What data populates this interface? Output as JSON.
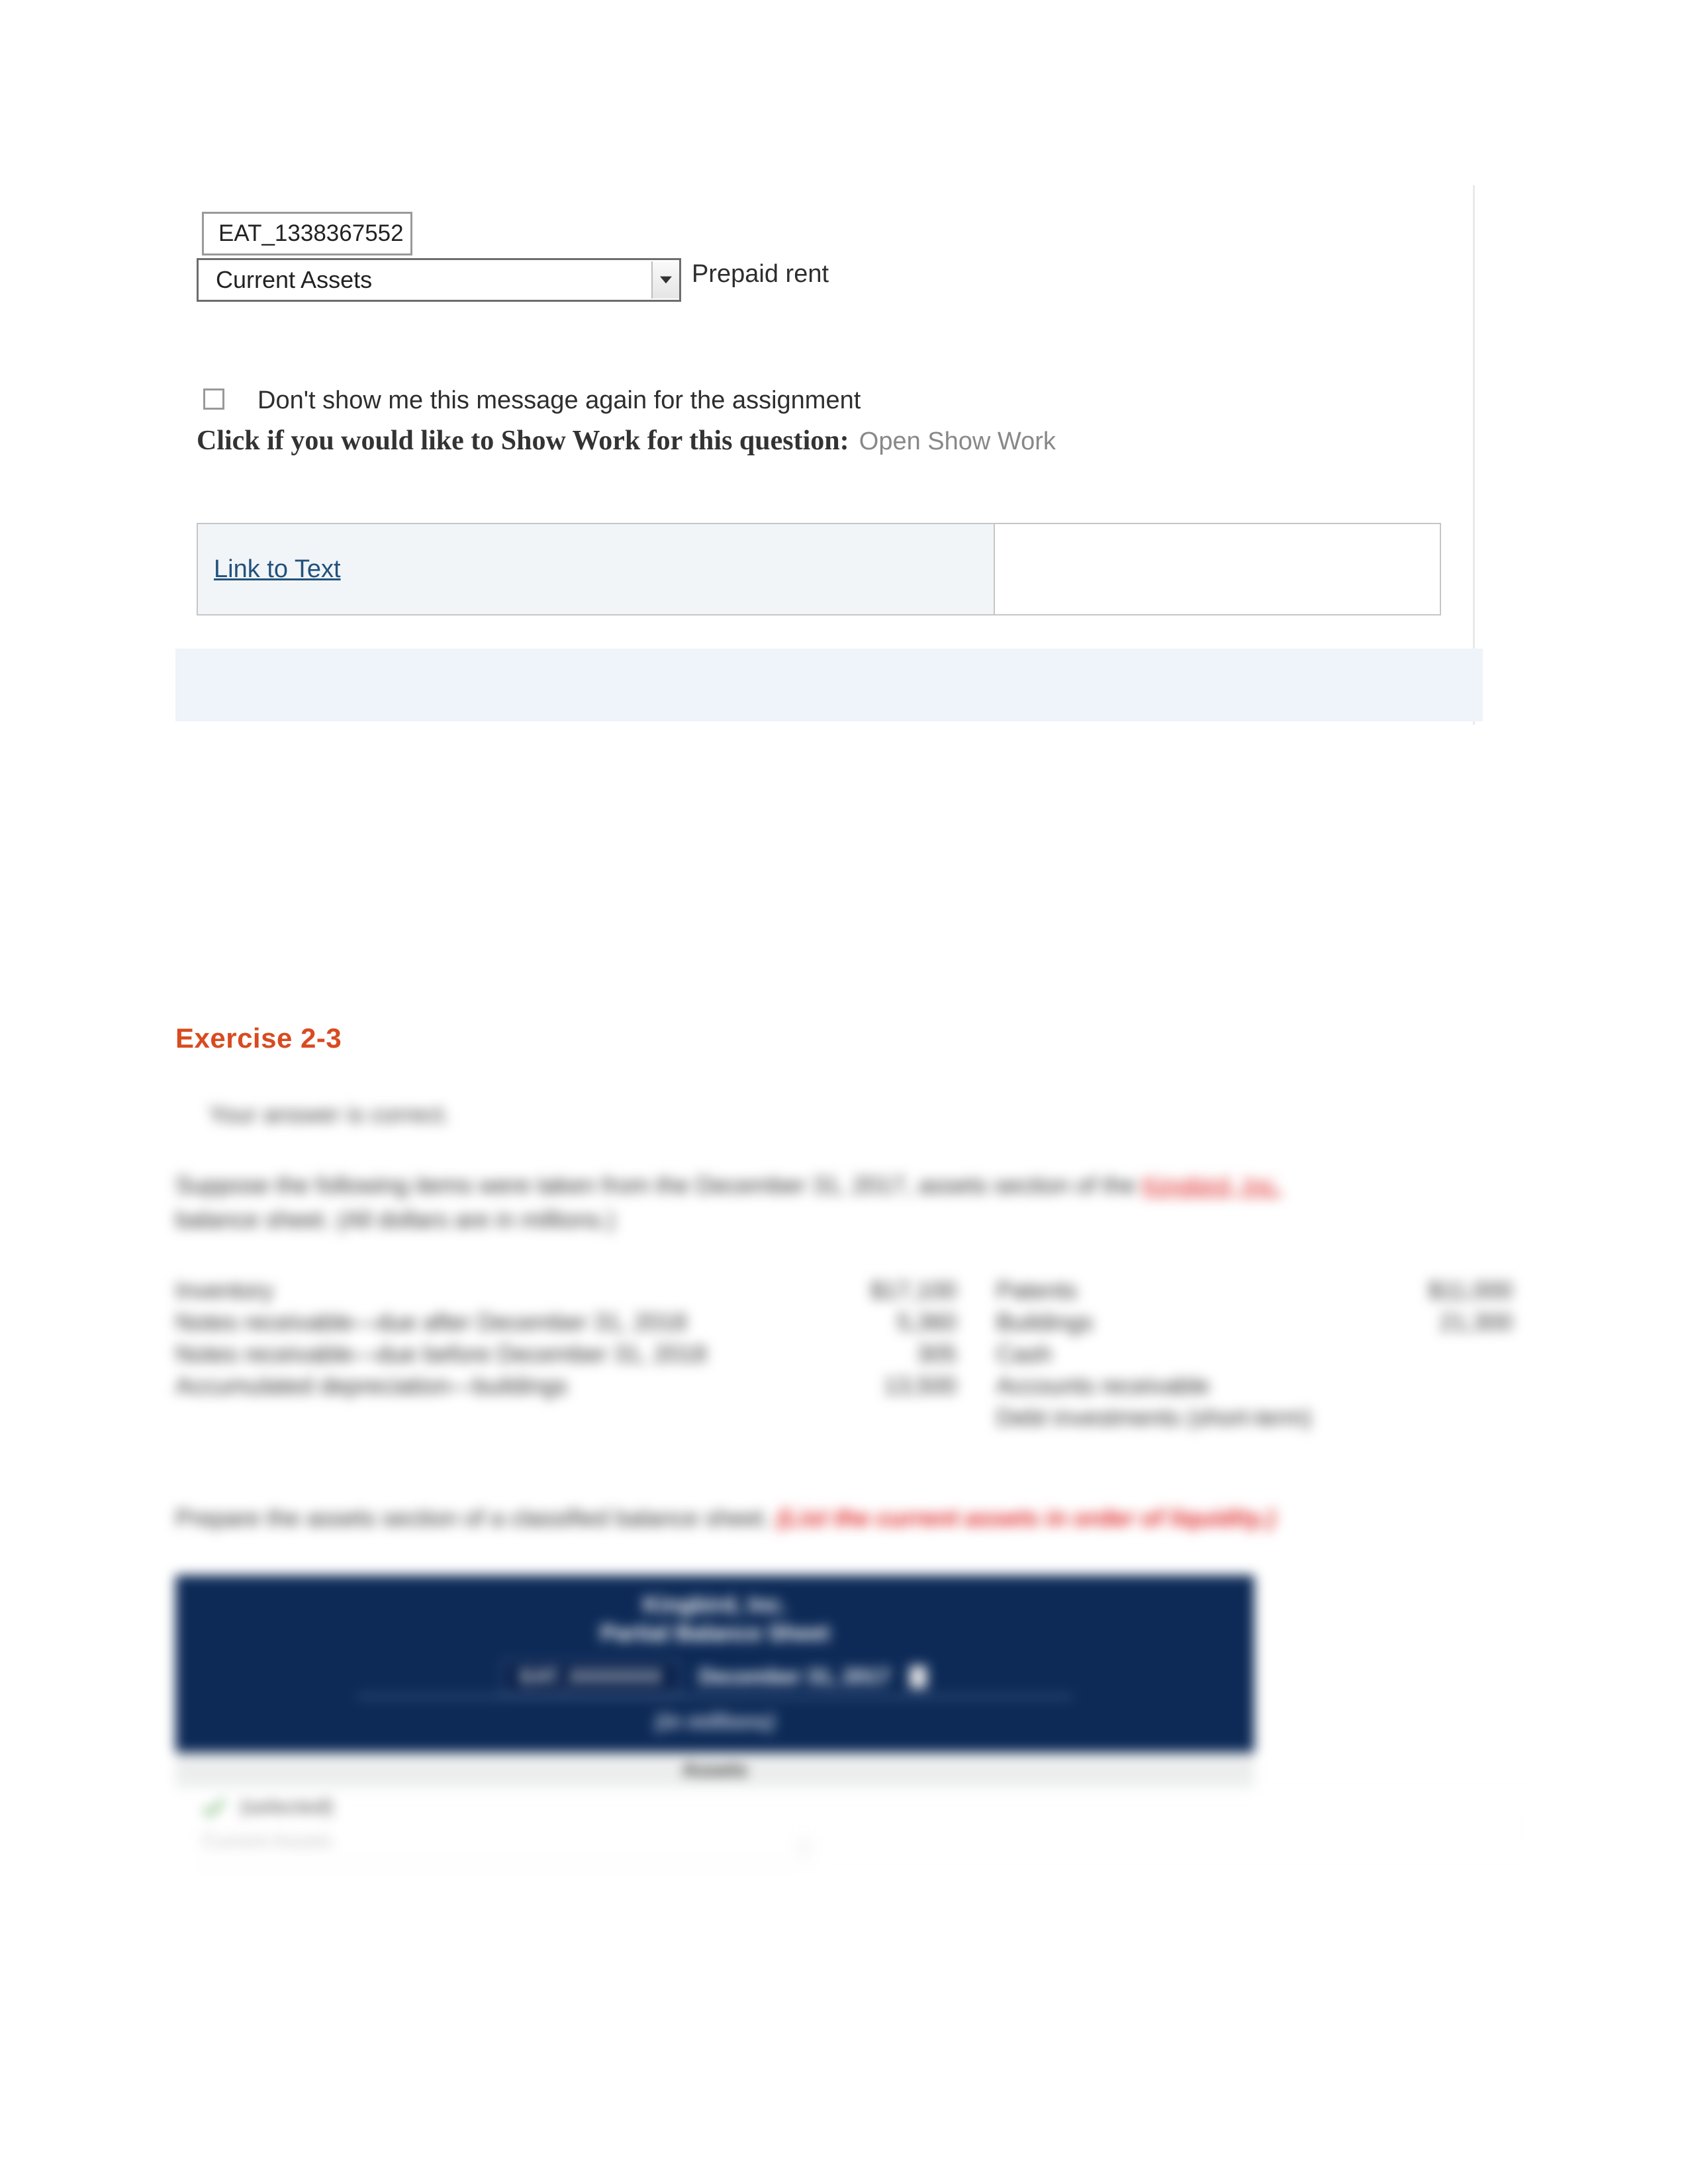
{
  "upper": {
    "eat_value": "EAT_1338367552",
    "dropdown_selected": "Current Assets",
    "right_label": "Prepaid rent",
    "checkbox_label": "Don't show me this message again for the assignment",
    "show_work_prompt": "Click if you would like to Show Work for this question:",
    "show_work_action": "Open Show Work",
    "link_text": "Link to Text"
  },
  "lower": {
    "exercise_title": "Exercise 2-3",
    "status_line": "Your answer is correct.",
    "para1_a": "Suppose the following items were taken from the December 31, 2017, assets section of the ",
    "para1_red": "Kingbird, Inc.",
    "para1_b": " balance sheet. (All dollars are in millions.)",
    "left_rows": [
      {
        "label": "Inventory",
        "val": "$17,100"
      },
      {
        "label": "Notes receivable—due after December 31, 2018",
        "val": "5,360"
      },
      {
        "label": "Notes receivable—due before December 31, 2018",
        "val": "305"
      },
      {
        "label": "Accumulated depreciation—buildings",
        "val": "13,500"
      }
    ],
    "right_rows": [
      {
        "label": "Patents",
        "val": "$11,000"
      },
      {
        "label": "Buildings",
        "val": "21,300"
      },
      {
        "label": "Cash",
        "val": ""
      },
      {
        "label": "Accounts receivable",
        "val": ""
      },
      {
        "label": "Debt investments (short-term)",
        "val": ""
      }
    ],
    "para2_a": "Prepare the assets section of a classified balance sheet. ",
    "para2_red": "(List the current assets in order of liquidity.)",
    "bs": {
      "company": "Kingbird, Inc.",
      "title": "Partial Balance Sheet",
      "date_chip": "EAT_XXXXXXX",
      "date_text": "December 31, 2017",
      "unit": "(in millions)",
      "section": "Assets",
      "row_check_label": "(selected)",
      "row2_label": "Current Assets"
    }
  }
}
